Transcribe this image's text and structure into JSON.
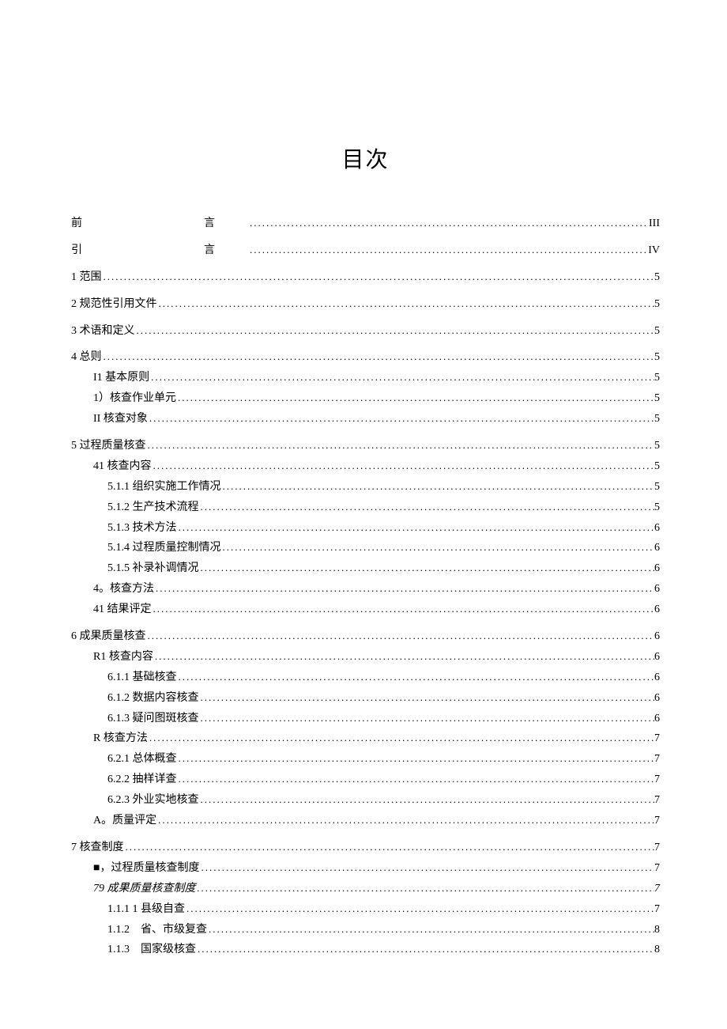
{
  "title": "目次",
  "entries": [
    {
      "label": "前　　言",
      "page": "III",
      "indent": 0,
      "wide": true,
      "group_start": false
    },
    {
      "label": "引　　言",
      "page": "IV",
      "indent": 0,
      "wide": true,
      "group_start": false
    },
    {
      "label": "1 范围",
      "page": "5",
      "indent": 0,
      "group_start": true
    },
    {
      "label": "2 规范性引用文件",
      "page": "5",
      "indent": 0,
      "group_start": true
    },
    {
      "label": "3 术语和定义",
      "page": "5",
      "indent": 0,
      "group_start": true
    },
    {
      "label": "4 总则",
      "page": "5",
      "indent": 0,
      "group_start": true
    },
    {
      "label": "I1 基本原则",
      "page": "5",
      "indent": 1
    },
    {
      "label": "1）核查作业单元 ",
      "page": "5",
      "indent": 1
    },
    {
      "label": "II 核查对象",
      "page": "5",
      "indent": 1
    },
    {
      "label": "5 过程质量核查",
      "page": "5",
      "indent": 0,
      "group_start": true
    },
    {
      "label": "41 核查内容 ",
      "page": "5",
      "indent": 1
    },
    {
      "label": "5.1.1 组织实施工作情况",
      "page": "5",
      "indent": 2
    },
    {
      "label": "5.1.2 生产技术流程",
      "page": "5",
      "indent": 2
    },
    {
      "label": "5.1.3 技术方法",
      "page": "6",
      "indent": 2
    },
    {
      "label": "5.1.4 过程质量控制情况",
      "page": "6",
      "indent": 2
    },
    {
      "label": "5.1.5 补录补调情况",
      "page": "6",
      "indent": 2
    },
    {
      "label": "4。核查方法 ",
      "page": "6",
      "indent": 1
    },
    {
      "label": "41 结果评定 ",
      "page": "6",
      "indent": 1
    },
    {
      "label": "6 成果质量核查",
      "page": "6",
      "indent": 0,
      "group_start": true
    },
    {
      "label": "R1 核查内容 ",
      "page": "6",
      "indent": 1
    },
    {
      "label": "6.1.1 基础核查",
      "page": "6",
      "indent": 2
    },
    {
      "label": "6.1.2 数据内容核查",
      "page": "6",
      "indent": 2
    },
    {
      "label": "6.1.3 疑问图斑核查",
      "page": "6",
      "indent": 2
    },
    {
      "label": "R 核查方法",
      "page": "7",
      "indent": 1
    },
    {
      "label": "6.2.1 总体概查",
      "page": "7",
      "indent": 2
    },
    {
      "label": "6.2.2 抽样详查",
      "page": "7",
      "indent": 2
    },
    {
      "label": "6.2.3 外业实地核查",
      "page": "7",
      "indent": 2
    },
    {
      "label": "A。质量评定 ",
      "page": "7",
      "indent": 1
    },
    {
      "label": "7 核查制度",
      "page": "7",
      "indent": 0,
      "group_start": true
    },
    {
      "label": "■，过程质量核查制度",
      "page": "7",
      "indent": 1
    },
    {
      "label": "79 成果质量核查制度 ",
      "page": "7",
      "indent": 1,
      "italic": true
    },
    {
      "label": "1.1.1 1 县级自查 ",
      "page": "7",
      "indent": 2
    },
    {
      "label": "1.1.2　省、市级复查 ",
      "page": "8",
      "indent": 2
    },
    {
      "label": "1.1.3　国家级核查 ",
      "page": "8",
      "indent": 2
    }
  ]
}
